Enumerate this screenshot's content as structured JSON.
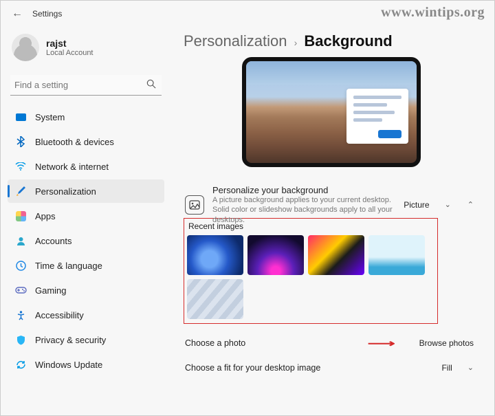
{
  "watermark": "www.wintips.org",
  "app_title": "Settings",
  "user": {
    "name": "rajst",
    "sub": "Local Account"
  },
  "search": {
    "placeholder": "Find a setting"
  },
  "nav": {
    "system": "System",
    "bluetooth": "Bluetooth & devices",
    "network": "Network & internet",
    "personalization": "Personalization",
    "apps": "Apps",
    "accounts": "Accounts",
    "time": "Time & language",
    "gaming": "Gaming",
    "accessibility": "Accessibility",
    "privacy": "Privacy & security",
    "update": "Windows Update"
  },
  "breadcrumb": {
    "parent": "Personalization",
    "current": "Background"
  },
  "bg_card": {
    "title": "Personalize your background",
    "sub": "A picture background applies to your current desktop. Solid color or slideshow backgrounds apply to all your desktops.",
    "select_value": "Picture"
  },
  "recent_label": "Recent images",
  "choose_photo": {
    "label": "Choose a photo",
    "button": "Browse photos"
  },
  "choose_fit": {
    "label": "Choose a fit for your desktop image",
    "value": "Fill"
  }
}
